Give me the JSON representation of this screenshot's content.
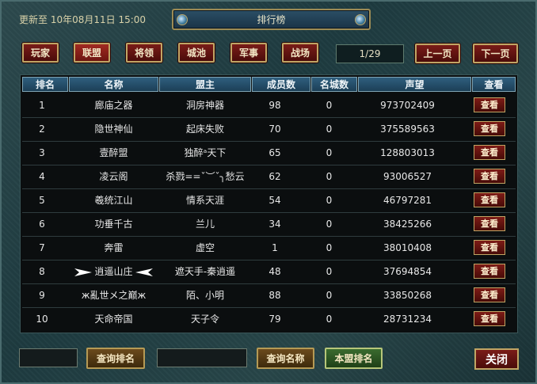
{
  "window": {
    "title": "排行榜",
    "updated": "更新至 10年08月11日 15:00",
    "close_label": "关闭"
  },
  "tabs": [
    {
      "label": "玩家",
      "selected": false
    },
    {
      "label": "联盟",
      "selected": true
    },
    {
      "label": "将领",
      "selected": false
    },
    {
      "label": "城池",
      "selected": false
    },
    {
      "label": "军事",
      "selected": false
    },
    {
      "label": "战场",
      "selected": false
    }
  ],
  "pager": {
    "page": "1/29",
    "prev_label": "上一页",
    "next_label": "下一页"
  },
  "table": {
    "headers": [
      "排名",
      "名称",
      "盟主",
      "成员数",
      "名城数",
      "声望",
      "查看"
    ],
    "view_label": "查看",
    "rows": [
      {
        "rank": "1",
        "name": "廊庙之器",
        "leader": "洞房神器",
        "members": "98",
        "cities": "0",
        "prestige": "973702409"
      },
      {
        "rank": "2",
        "name": "隐世神仙",
        "leader": "起床失败",
        "members": "70",
        "cities": "0",
        "prestige": "375589563"
      },
      {
        "rank": "3",
        "name": "壹醉盟",
        "leader": "独醉ᵃ天下",
        "members": "65",
        "cities": "0",
        "prestige": "128803013"
      },
      {
        "rank": "4",
        "name": "凌云阁",
        "leader": "杀戮==ˇ︶ˇ╮愁云",
        "members": "62",
        "cities": "0",
        "prestige": "93006527"
      },
      {
        "rank": "5",
        "name": "羲统江山",
        "leader": "情系天涯",
        "members": "54",
        "cities": "0",
        "prestige": "46797281"
      },
      {
        "rank": "6",
        "name": "功垂千古",
        "leader": "兰儿",
        "members": "34",
        "cities": "0",
        "prestige": "38425266"
      },
      {
        "rank": "7",
        "name": "奔雷",
        "leader": "虚空",
        "members": "1",
        "cities": "0",
        "prestige": "38010408"
      },
      {
        "rank": "8",
        "name": "逍遥山庄",
        "leader": "遮天手-秦逍遥",
        "members": "48",
        "cities": "0",
        "prestige": "37694854"
      },
      {
        "rank": "9",
        "name": "ж亂世メ之巅ж",
        "leader": "陌、小明",
        "members": "88",
        "cities": "0",
        "prestige": "33850268"
      },
      {
        "rank": "10",
        "name": "天命帝国",
        "leader": "天子令",
        "members": "79",
        "cities": "0",
        "prestige": "28731234"
      }
    ]
  },
  "footer": {
    "rank_query_label": "查询排名",
    "name_query_label": "查询名称",
    "own_rank_label": "本盟排名"
  },
  "colors": {
    "accent_red": "#7a1c18",
    "gold_border": "#c0a564",
    "header_blue": "#2f5f7e"
  }
}
